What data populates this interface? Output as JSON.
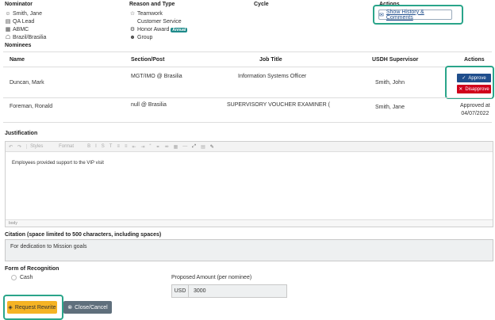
{
  "header": {
    "nominator_label": "Nominator",
    "reason_label": "Reason and Type",
    "cycle_label": "Cycle",
    "actions_label": "Actions",
    "show_history_label": "Show History & Comments"
  },
  "nominator": {
    "name": "Smith, Jane",
    "role": "QA Lead",
    "org": "ABMC",
    "location": "Brazil/Brasilia"
  },
  "reason": {
    "items": [
      "Teamwork",
      "Customer Service",
      "Honor Award",
      "Group"
    ],
    "badge": "Annual"
  },
  "nominees": {
    "title": "Nominees",
    "columns": [
      "Name",
      "Section/Post",
      "Job Title",
      "USDH Supervisor",
      "Actions"
    ],
    "rows": [
      {
        "name": "Duncan, Mark",
        "section": "MGT/IMO @ Brasilia",
        "job": "Information Systems Officer",
        "supervisor": "Smith, John"
      },
      {
        "name": "Foreman, Ronald",
        "section": "null @ Brasilia",
        "job": "SUPERVISORY VOUCHER EXAMINER (",
        "supervisor": "Smith, Jane",
        "status_line1": "Approved at",
        "status_line2": "04/07/2022"
      }
    ],
    "approve_label": "Approve",
    "disapprove_label": "Disapprove"
  },
  "justification": {
    "label": "Justification",
    "toolbar_styles": "Styles",
    "toolbar_format": "Format",
    "text": "Employees provided support to the VIP visit",
    "status": "body"
  },
  "citation": {
    "label": "Citation (space limited to 500 characters, including spaces)",
    "text": "For dedication to Mission goals"
  },
  "recognition": {
    "label": "Form of Recognition",
    "cash_label": "Cash",
    "amount_label": "Proposed Amount (per nominee)",
    "currency": "USD",
    "amount": "3000"
  },
  "footer": {
    "request_rewrite_label": "Request Rewrite",
    "close_label": "Close/Cancel"
  },
  "colors": {
    "approve": "#1f4e8c",
    "disapprove": "#d0021b",
    "highlight": "#2aa58a",
    "request_rewrite": "#f5b324",
    "close": "#5f6f7c",
    "badge": "#1e8a8a"
  }
}
